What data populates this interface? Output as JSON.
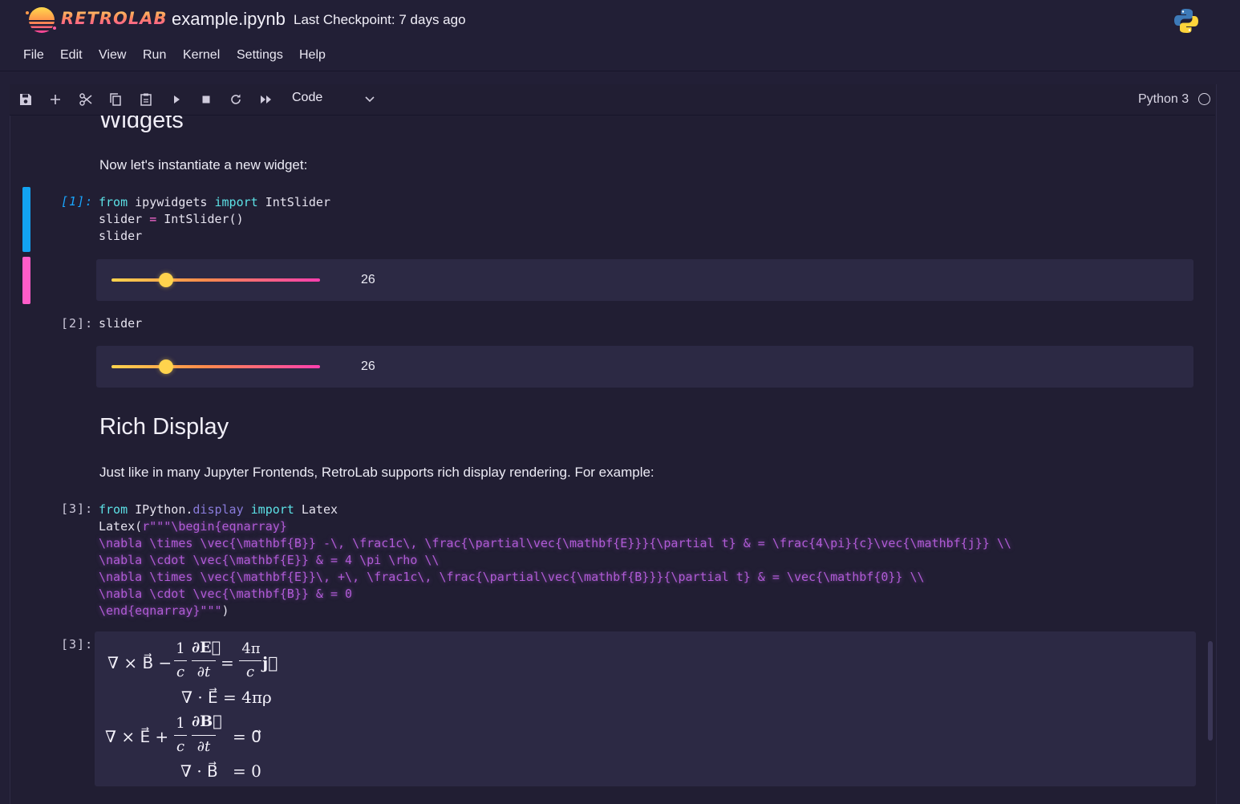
{
  "header": {
    "brand": "RETROLAB",
    "notebook_name": "example.ipynb",
    "checkpoint": "Last Checkpoint: 7 days ago"
  },
  "menu": [
    "File",
    "Edit",
    "View",
    "Run",
    "Kernel",
    "Settings",
    "Help"
  ],
  "toolbar": {
    "buttons": [
      "save-icon",
      "add-cell-icon",
      "cut-icon",
      "copy-icon",
      "paste-icon",
      "run-icon",
      "stop-icon",
      "restart-icon",
      "run-all-icon"
    ],
    "cell_type": "Code",
    "kernel": "Python 3"
  },
  "cells": {
    "widgets_heading": "Widgets",
    "widgets_text": "Now let's instantiate a new widget:",
    "cell1": {
      "prompt": "[1]:",
      "line1": {
        "kw1": "from",
        "mod": " ipywidgets ",
        "kw2": "import",
        "name": " IntSlider"
      },
      "line2": {
        "a": "slider ",
        "op": "=",
        "b": " IntSlider()"
      },
      "line3": "slider",
      "slider_value": "26",
      "slider_fraction": 0.26
    },
    "cell2": {
      "prompt": "[2]:",
      "code": "slider",
      "slider_value": "26",
      "slider_fraction": 0.26
    },
    "rich_heading": "Rich Display",
    "rich_text": "Just like in many Jupyter Frontends, RetroLab supports rich display rendering. For example:",
    "cell3": {
      "prompt": "[3]:",
      "output_prompt": "[3]:",
      "line1": {
        "kw1": "from",
        "mod": " IPython.",
        "attr": "display",
        "sp": " ",
        "kw2": "import",
        "name": " Latex"
      },
      "line2_a": "Latex(",
      "line2_b": "r\"\"\"\\begin{eqnarray}",
      "line3": "\\nabla \\times \\vec{\\mathbf{B}} -\\, \\frac1c\\, \\frac{\\partial\\vec{\\mathbf{E}}}{\\partial t} & = \\frac{4\\pi}{c}\\vec{\\mathbf{j}} \\\\",
      "line4": "\\nabla \\cdot \\vec{\\mathbf{E}} & = 4 \\pi \\rho \\\\",
      "line5": "\\nabla \\times \\vec{\\mathbf{E}}\\, +\\, \\frac1c\\, \\frac{\\partial\\vec{\\mathbf{B}}}{\\partial t} & = \\vec{\\mathbf{0}} \\\\",
      "line6": "\\nabla \\cdot \\vec{\\mathbf{B}} & = 0",
      "line7_a": "\\end{eqnarray}\"\"\"",
      "line7_b": ")",
      "math": {
        "eq1_lhs": "∇ × B⃗ −",
        "eq1_frac_a_num": "1",
        "eq1_frac_a_den": "c",
        "eq1_frac_b_num": "∂E⃗",
        "eq1_frac_b_den": "∂t",
        "eq1_eq": "=",
        "eq1_frac_c_num": "4π",
        "eq1_frac_c_den": "c",
        "eq1_j": "j⃗",
        "eq2_lhs": "∇ · E⃗",
        "eq2_rhs": "= 4πρ",
        "eq3_lhs": "∇ × E⃗ +",
        "eq3_frac_a_num": "1",
        "eq3_frac_a_den": "c",
        "eq3_frac_b_num": "∂B⃗",
        "eq3_frac_b_den": "∂t",
        "eq3_rhs": "= 0⃗",
        "eq4_lhs": "∇ · B⃗",
        "eq4_rhs": "= 0"
      }
    }
  }
}
